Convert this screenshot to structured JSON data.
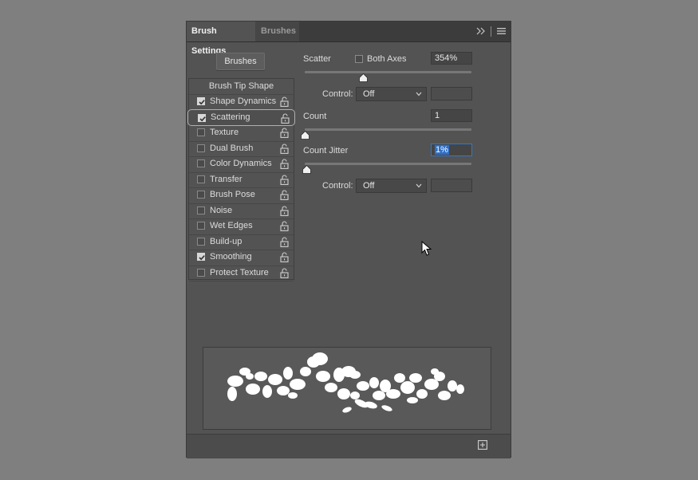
{
  "tabs": [
    {
      "label": "Brush Settings",
      "active": true
    },
    {
      "label": "Brushes",
      "active": false
    }
  ],
  "brushes_button": "Brushes",
  "list_header": "Brush Tip Shape",
  "list_items": [
    {
      "label": "Shape Dynamics",
      "checked": true
    },
    {
      "label": "Scattering",
      "checked": true,
      "selected": true
    },
    {
      "label": "Texture",
      "checked": false
    },
    {
      "label": "Dual Brush",
      "checked": false
    },
    {
      "label": "Color Dynamics",
      "checked": false
    },
    {
      "label": "Transfer",
      "checked": false
    },
    {
      "label": "Brush Pose",
      "checked": false
    },
    {
      "label": "Noise",
      "checked": false
    },
    {
      "label": "Wet Edges",
      "checked": false
    },
    {
      "label": "Build-up",
      "checked": false
    },
    {
      "label": "Smoothing",
      "checked": true
    },
    {
      "label": "Protect Texture",
      "checked": false
    }
  ],
  "scatter": {
    "label": "Scatter",
    "both_axes_label": "Both Axes",
    "both_axes_checked": false,
    "value": "354%",
    "slider_fraction": 0.35,
    "control_label": "Control:",
    "control_value": "Off",
    "control_aux": ""
  },
  "count": {
    "label": "Count",
    "value": "1",
    "slider_fraction": 0.0
  },
  "count_jitter": {
    "label": "Count Jitter",
    "value": "1%",
    "slider_fraction": 0.01,
    "control_label": "Control:",
    "control_value": "Off",
    "control_aux": ""
  },
  "colors": {
    "panel": "#535353",
    "tabbar": "#3c3c3c",
    "selection": "#2f6fc6",
    "background": "#7f7f7f"
  },
  "icons": {
    "collapse": "double-chevron-right-icon",
    "menu": "hamburger-menu-icon",
    "lock": "lock-icon",
    "new_brush": "new-brush-icon",
    "cursor": "mouse-cursor-icon"
  }
}
